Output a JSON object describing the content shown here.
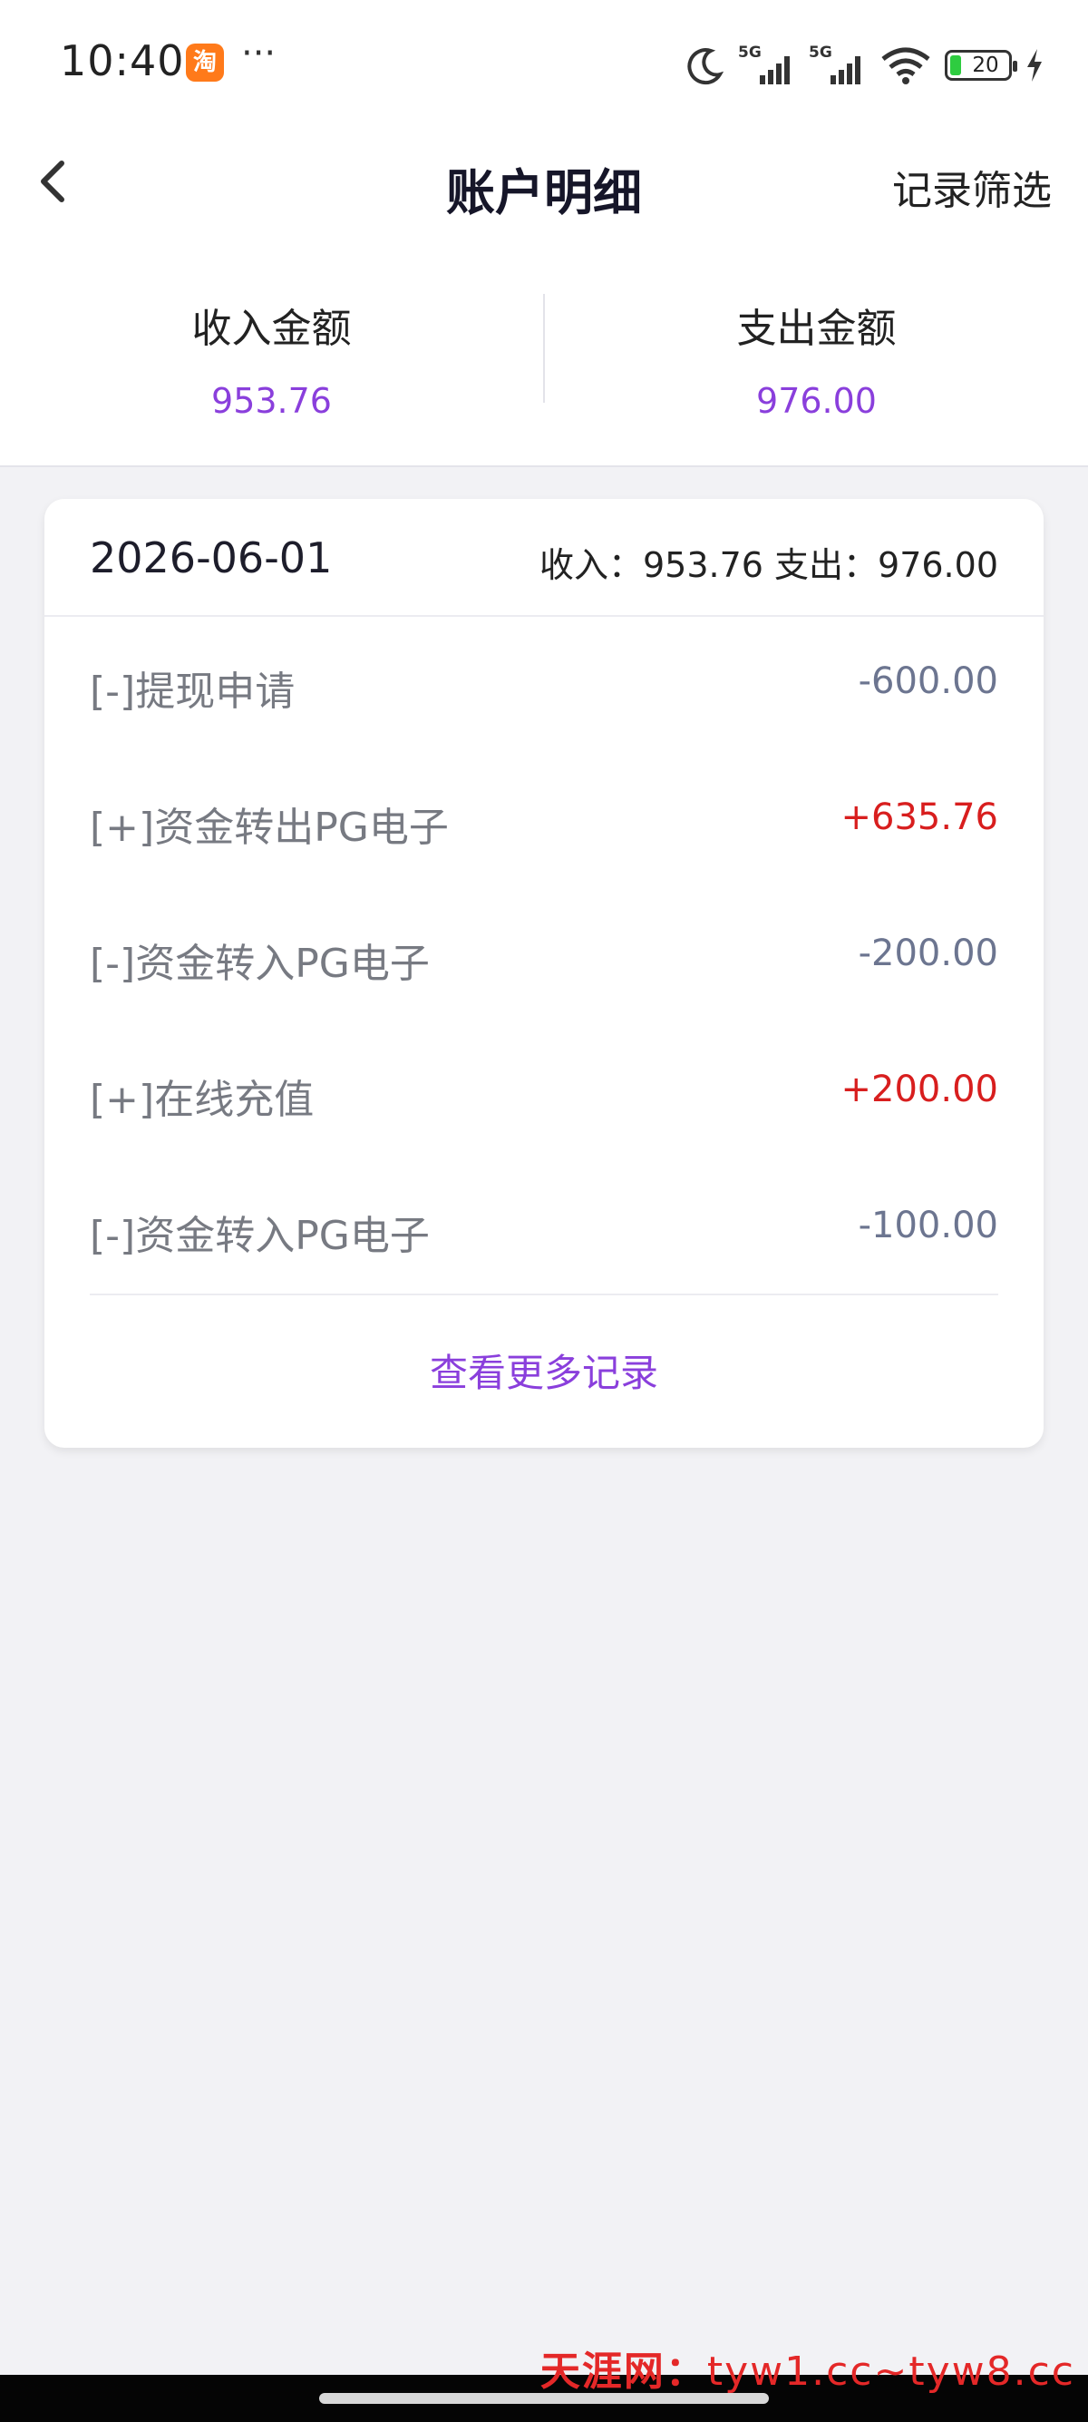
{
  "status_bar": {
    "time": "10:40",
    "app_badge": "淘",
    "more": "···",
    "battery_level": "20",
    "network_1": "5G",
    "network_2": "5G"
  },
  "nav": {
    "title": "账户明细",
    "filter_label": "记录筛选"
  },
  "summary": {
    "income_label": "收入金额",
    "income_value": "953.76",
    "expense_label": "支出金额",
    "expense_value": "976.00"
  },
  "card": {
    "date": "2026-06-01",
    "totals": "收入：953.76 支出：976.00",
    "items": [
      {
        "label": "[-]提现申请",
        "amount": "-600.00",
        "type": "negative"
      },
      {
        "label": "[+]资金转出PG电子",
        "amount": "+635.76",
        "type": "positive"
      },
      {
        "label": "[-]资金转入PG电子",
        "amount": "-200.00",
        "type": "negative"
      },
      {
        "label": "[+]在线充值",
        "amount": "+200.00",
        "type": "positive"
      },
      {
        "label": "[-]资金转入PG电子",
        "amount": "-100.00",
        "type": "negative"
      }
    ],
    "more_link": "查看更多记录"
  },
  "watermark": {
    "brand": "天涯网：",
    "url": "tyw1.cc~tyw8.cc"
  },
  "colors": {
    "accent_purple": "#8a3fdc",
    "positive_red": "#d81e1e",
    "negative_gray": "#6c7590",
    "background": "#f2f2f5"
  }
}
